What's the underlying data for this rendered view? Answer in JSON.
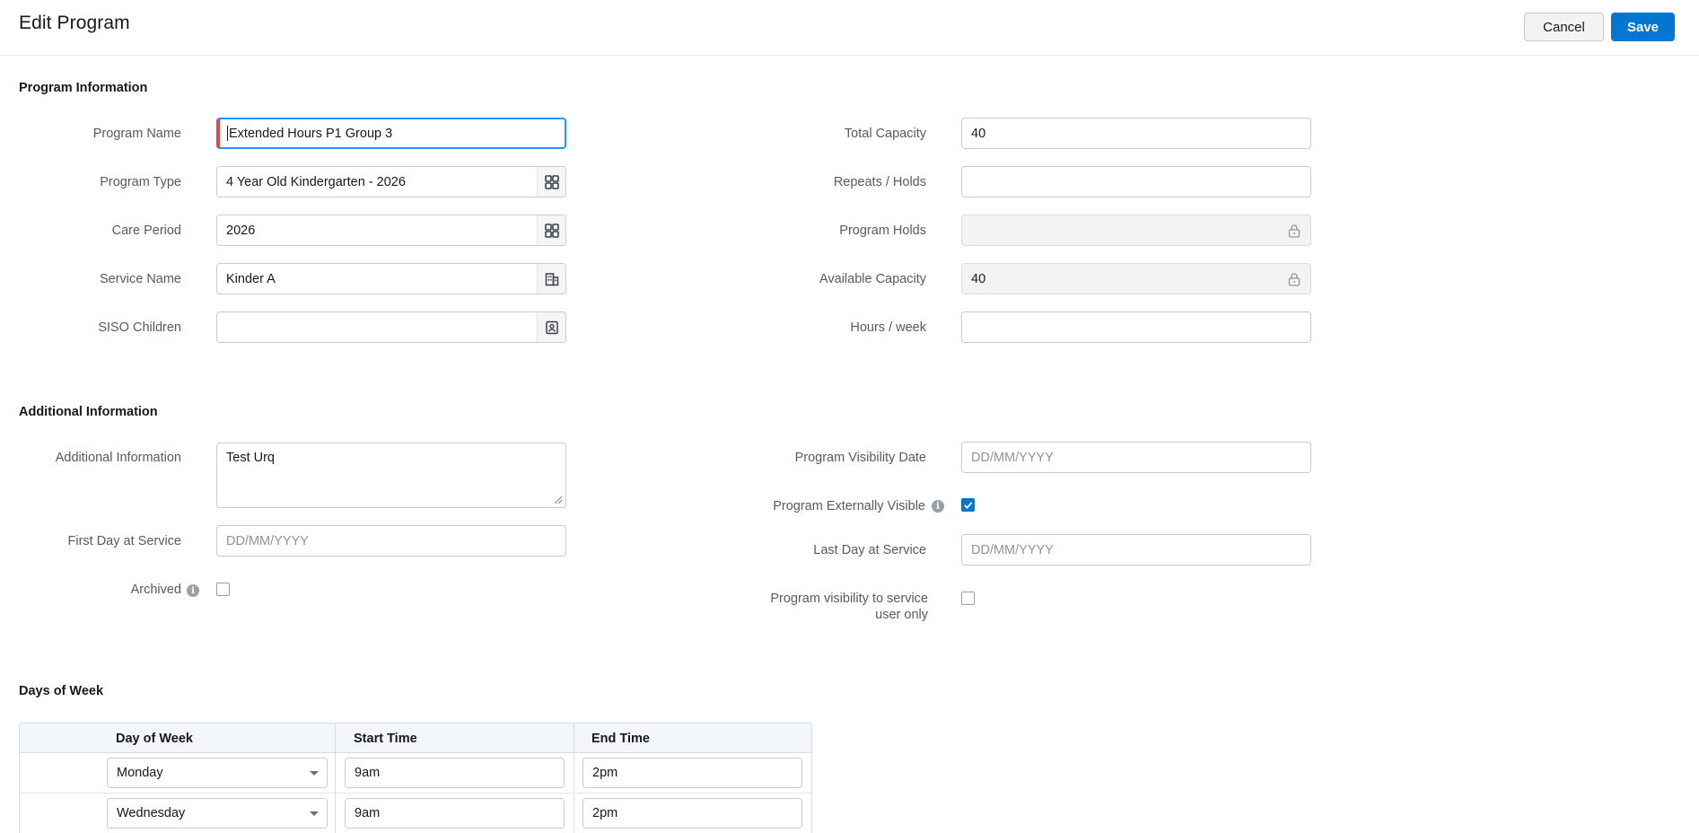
{
  "header": {
    "title": "Edit Program",
    "cancel_label": "Cancel",
    "save_label": "Save"
  },
  "program_information": {
    "section_title": "Program Information",
    "program_name": {
      "label": "Program Name",
      "value": "Extended Hours P1 Group 3"
    },
    "program_type": {
      "label": "Program Type",
      "value": "4 Year Old Kindergarten - 2026",
      "icon": "lookup-grid-icon"
    },
    "care_period": {
      "label": "Care Period",
      "value": "2026",
      "icon": "lookup-grid-icon"
    },
    "service_name": {
      "label": "Service Name",
      "value": "Kinder A",
      "icon": "building-icon"
    },
    "siso_children": {
      "label": "SISO Children",
      "value": "",
      "icon": "contact-card-icon"
    },
    "total_capacity": {
      "label": "Total Capacity",
      "value": "40"
    },
    "repeats_holds": {
      "label": "Repeats / Holds",
      "value": ""
    },
    "program_holds": {
      "label": "Program Holds",
      "value": "",
      "icon": "lock-icon"
    },
    "available_capacity": {
      "label": "Available Capacity",
      "value": "40",
      "icon": "lock-icon"
    },
    "hours_week": {
      "label": "Hours / week",
      "value": ""
    }
  },
  "additional_information": {
    "section_title": "Additional Information",
    "additional_info": {
      "label": "Additional Information",
      "value": "Test Urq"
    },
    "first_day": {
      "label": "First Day at Service",
      "placeholder": "DD/MM/YYYY"
    },
    "archived": {
      "label": "Archived",
      "checked": false
    },
    "visibility_date": {
      "label": "Program Visibility Date",
      "placeholder": "DD/MM/YYYY"
    },
    "externally_visible": {
      "label": "Program Externally Visible",
      "checked": true
    },
    "last_day": {
      "label": "Last Day at Service",
      "placeholder": "DD/MM/YYYY"
    },
    "service_user_only": {
      "label_line1": "Program visibility to service",
      "label_line2": "user only",
      "checked": false
    }
  },
  "days_of_week": {
    "section_title": "Days of Week",
    "columns": [
      "Day of Week",
      "Start Time",
      "End Time"
    ],
    "rows": [
      {
        "day": "Monday",
        "start": "9am",
        "end": "2pm"
      },
      {
        "day": "Wednesday",
        "start": "9am",
        "end": "2pm"
      }
    ]
  },
  "colors": {
    "accent": "#0176d3",
    "focus_border": "#1b96ff",
    "required_marker": "#e04a4a"
  }
}
